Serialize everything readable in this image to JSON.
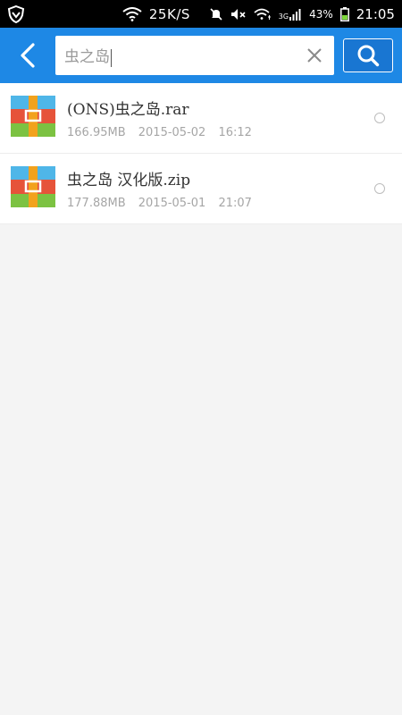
{
  "status_bar": {
    "network_speed": "25K/S",
    "network_type": "3G",
    "battery_percent": "43%",
    "time": "21:05"
  },
  "toolbar": {
    "search_value": "虫之岛"
  },
  "files": [
    {
      "name": "(ONS)虫之岛.rar",
      "size": "166.95MB",
      "date": "2015-05-02",
      "time": "16:12"
    },
    {
      "name": "虫之岛 汉化版.zip",
      "size": "177.88MB",
      "date": "2015-05-01",
      "time": "21:07"
    }
  ],
  "colors": {
    "toolbar_bg": "#1e88e5",
    "status_bg": "#000000",
    "page_bg": "#f4f4f4"
  }
}
